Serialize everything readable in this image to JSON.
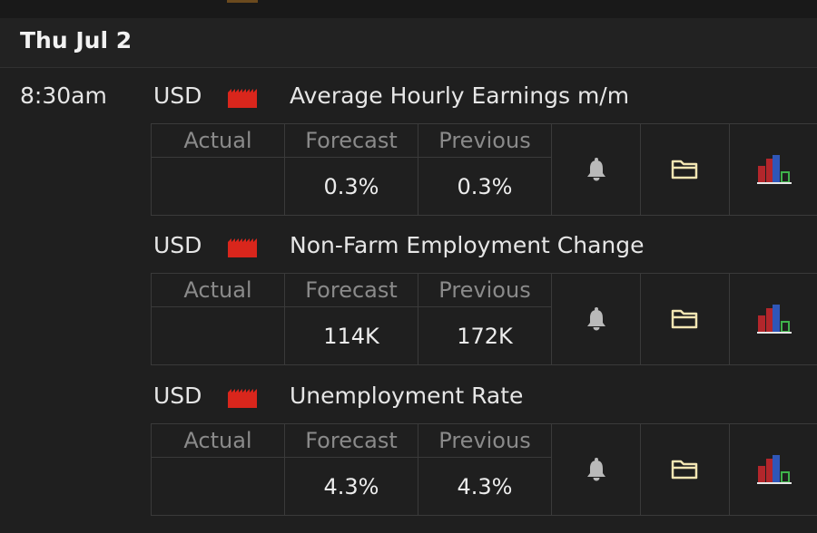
{
  "date_header": {
    "label": "Thu Jul 2"
  },
  "time_label": "8:30am",
  "events": [
    {
      "currency": "USD",
      "impact_icon": "high-impact-icon",
      "title": "Average Hourly Earnings m/m",
      "headers": {
        "actual": "Actual",
        "forecast": "Forecast",
        "previous": "Previous"
      },
      "actual": "",
      "forecast": "0.3%",
      "previous": "0.3%"
    },
    {
      "currency": "USD",
      "impact_icon": "high-impact-icon",
      "title": "Non-Farm Employment Change",
      "headers": {
        "actual": "Actual",
        "forecast": "Forecast",
        "previous": "Previous"
      },
      "actual": "",
      "forecast": "114K",
      "previous": "172K"
    },
    {
      "currency": "USD",
      "impact_icon": "high-impact-icon",
      "title": "Unemployment Rate",
      "headers": {
        "actual": "Actual",
        "forecast": "Forecast",
        "previous": "Previous"
      },
      "actual": "",
      "forecast": "4.3%",
      "previous": "4.3%"
    }
  ],
  "action_icons": [
    "bell-icon",
    "folder-icon",
    "chart-icon"
  ],
  "colors": {
    "background": "#1f1f1f",
    "impact_high": "#d9261c",
    "bell": "#b9b9b9",
    "folder": "#f3e6b3",
    "chart_red": "#b3262b",
    "chart_blue": "#2f56b8",
    "chart_green": "#3fb24b"
  }
}
